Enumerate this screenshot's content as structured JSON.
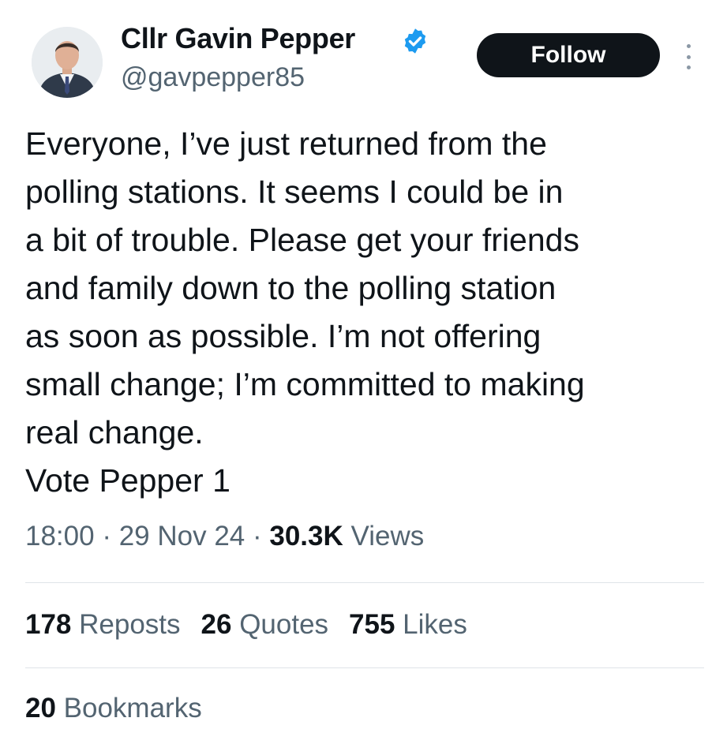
{
  "author": {
    "display_name": "Cllr Gavin Pepper",
    "handle": "@gavpepper85",
    "avatar_icon": "person-in-suit-avatar",
    "verified_icon": "verified-badge-icon",
    "verified_color": "#1d9bf0"
  },
  "actions": {
    "follow_label": "Follow",
    "more_icon": "more-options-icon"
  },
  "tweet": {
    "lines": [
      "Everyone, I’ve just returned from the",
      "polling stations. It seems I could be in",
      "a bit of trouble. Please get your friends",
      "and family down to the polling station",
      "as soon as possible. I’m not offering",
      "small change; I’m committed to making",
      "real change.",
      "Vote Pepper 1"
    ]
  },
  "meta": {
    "time": "18:00",
    "separator": " · ",
    "date": "29 Nov 24",
    "views_count": "30.3K",
    "views_label": " Views"
  },
  "stats": {
    "reposts_count": "178",
    "reposts_label": " Reposts",
    "quotes_count": "26",
    "quotes_label": " Quotes",
    "likes_count": "755",
    "likes_label": " Likes",
    "bookmarks_count": "20",
    "bookmarks_label": " Bookmarks"
  },
  "colors": {
    "text_primary": "#0f1419",
    "text_secondary": "#536471",
    "follow_bg": "#0f1419",
    "divider": "#dfe4e8"
  }
}
